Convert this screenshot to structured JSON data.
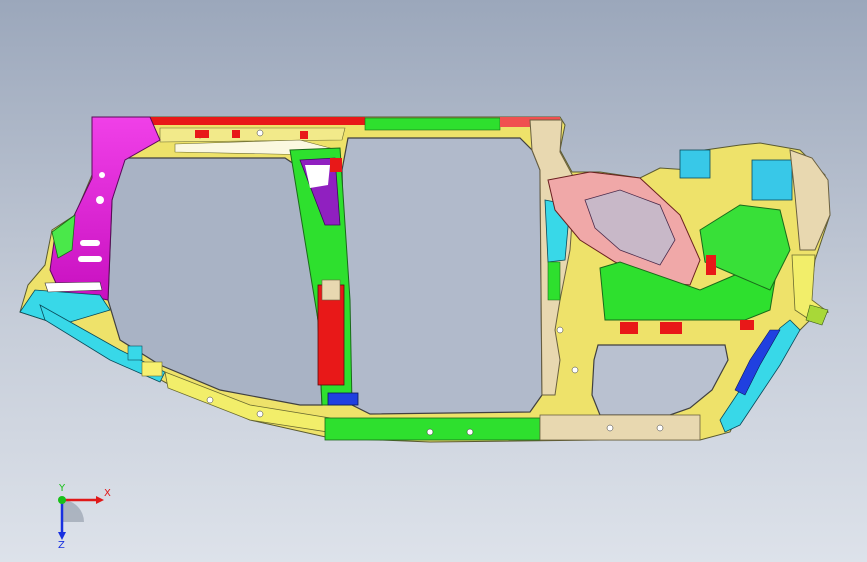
{
  "viewport": {
    "background_top": "#9ba7bb",
    "background_bottom": "#dde2ea"
  },
  "model": {
    "description_icon": "car-body-side-frame-assembly",
    "part_colors": {
      "magenta": "#e020d8",
      "yellow": "#f2ee6a",
      "cyan": "#38d8e8",
      "green": "#2ee02e",
      "red": "#e81818",
      "blue": "#2040e0",
      "tan": "#e8d8b0",
      "pink": "#f0a8a8",
      "purple": "#9020c0",
      "white": "#ffffff",
      "olive": "#a8c838"
    }
  },
  "triad": {
    "x_label": "X",
    "y_label": "Y",
    "z_label": "Z",
    "x_color": "#e01818",
    "y_color": "#18c018",
    "z_color": "#1830e0"
  }
}
